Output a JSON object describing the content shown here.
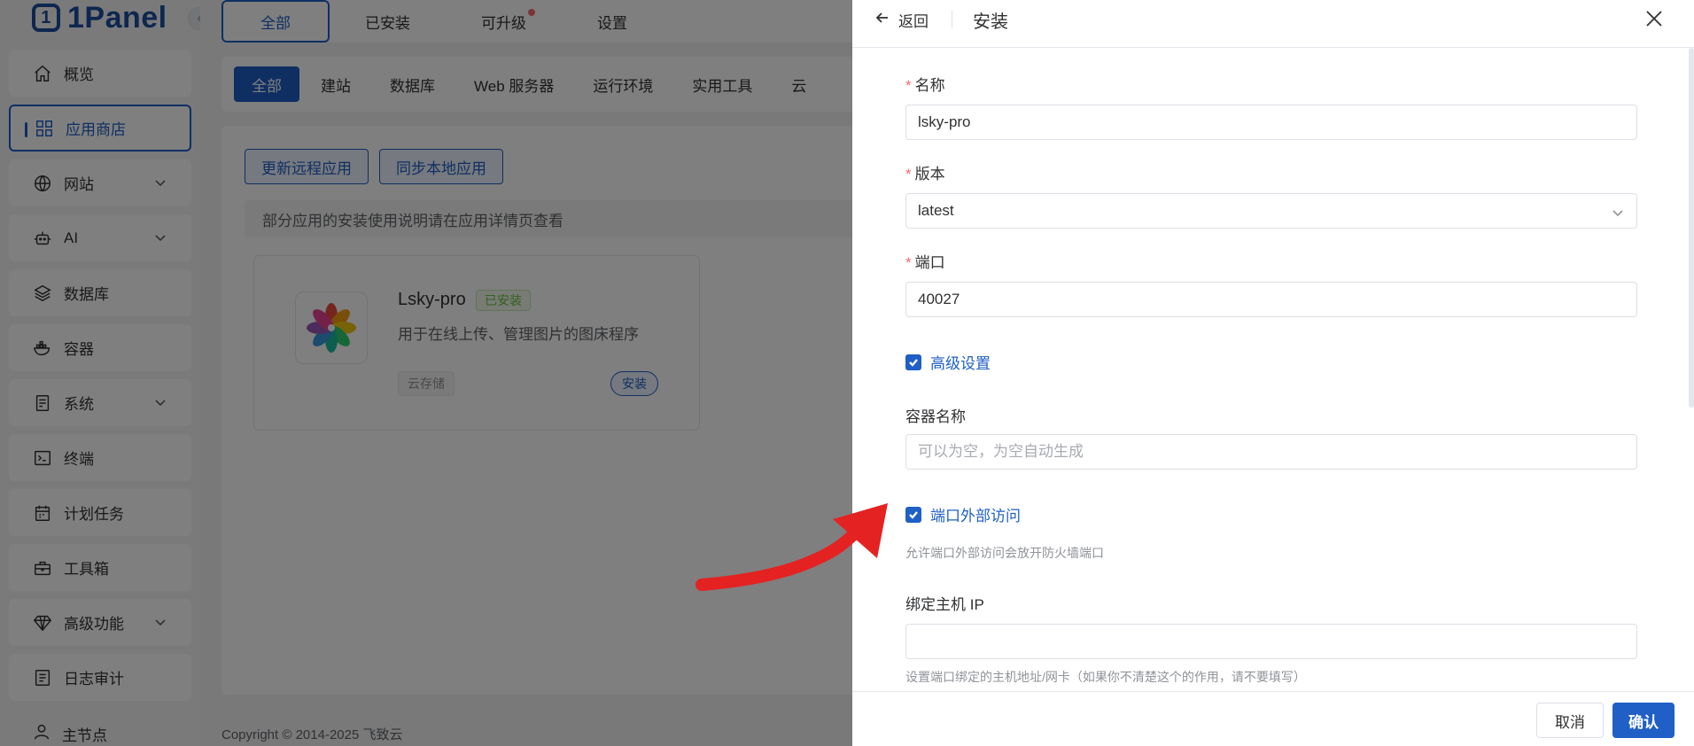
{
  "sidebar": {
    "logo_text": "1Panel",
    "items": [
      {
        "label": "概览",
        "icon": "home-icon"
      },
      {
        "label": "应用商店",
        "icon": "apps-grid-icon",
        "active": true
      },
      {
        "label": "网站",
        "icon": "globe-icon",
        "expandable": true
      },
      {
        "label": "AI",
        "icon": "robot-icon",
        "expandable": true
      },
      {
        "label": "数据库",
        "icon": "layers-icon"
      },
      {
        "label": "容器",
        "icon": "docker-icon"
      },
      {
        "label": "系统",
        "icon": "server-icon",
        "expandable": true
      },
      {
        "label": "终端",
        "icon": "terminal-icon"
      },
      {
        "label": "计划任务",
        "icon": "calendar-icon"
      },
      {
        "label": "工具箱",
        "icon": "toolbox-icon"
      },
      {
        "label": "高级功能",
        "icon": "diamond-icon",
        "expandable": true
      },
      {
        "label": "日志审计",
        "icon": "log-icon"
      }
    ],
    "bottom_label": "主节点"
  },
  "top_tabs": [
    "全部",
    "已安装",
    "可升级",
    "设置"
  ],
  "categories": [
    "全部",
    "建站",
    "数据库",
    "Web 服务器",
    "运行环境",
    "实用工具",
    "云"
  ],
  "actions": {
    "update_remote": "更新远程应用",
    "sync_local": "同步本地应用"
  },
  "tip": "部分应用的安装使用说明请在应用详情页查看",
  "app": {
    "name": "Lsky-pro",
    "badge": "已安装",
    "description": "用于在线上传、管理图片的图床程序",
    "tag": "云存储",
    "install_label": "安装"
  },
  "copyright": "Copyright © 2014-2025 飞致云",
  "drawer": {
    "back_label": "返回",
    "title": "安装",
    "name_label": "名称",
    "name_value": "lsky-pro",
    "version_label": "版本",
    "version_value": "latest",
    "port_label": "端口",
    "port_value": "40027",
    "advanced_label": "高级设置",
    "container_name_label": "容器名称",
    "container_name_placeholder": "可以为空，为空自动生成",
    "external_access_label": "端口外部访问",
    "external_access_hint": "允许端口外部访问会放开防火墙端口",
    "bind_ip_label": "绑定主机 IP",
    "bind_ip_value": "",
    "bind_ip_hint": "设置端口绑定的主机地址/网卡（如果你不清楚这个的作用，请不要填写）",
    "cancel_label": "取消",
    "confirm_label": "确认"
  },
  "colors": {
    "primary": "#1f5fc6",
    "annotation_arrow": "#e52222",
    "required": "#f56c6c"
  }
}
